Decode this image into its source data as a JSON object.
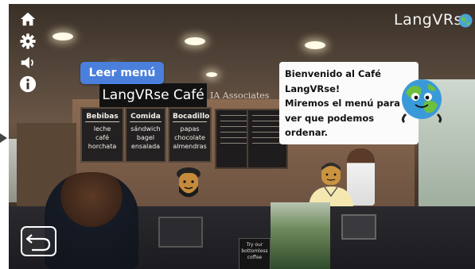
{
  "scene": {
    "title_sign": "LangVRse Café",
    "wall_sign": "IA Associates",
    "menu_boards": [
      {
        "heading": "Bebibas",
        "items": [
          "leche",
          "café",
          "horchata"
        ]
      },
      {
        "heading": "Comida",
        "items": [
          "sándwich",
          "bagel",
          "ensalada"
        ]
      },
      {
        "heading": "Bocadillo",
        "items": [
          "papas",
          "chocolate",
          "almendras"
        ]
      }
    ],
    "promo_sign": "Try our bottomless coffee"
  },
  "buttons": {
    "read_menu": "Leer menú"
  },
  "dialog": {
    "lines": [
      "Bienvenido al Café",
      "LangVRse!",
      "Miremos el menú para",
      "ver que podemos",
      "ordenar."
    ]
  },
  "brand": {
    "logo_text": "LangVRse"
  },
  "toolbar": {
    "icons": [
      "home-icon",
      "settings-icon",
      "volume-icon",
      "info-icon"
    ]
  },
  "colors": {
    "accent": "#4a7fdc",
    "bubble": "#fbfbfb",
    "board": "#232021"
  }
}
